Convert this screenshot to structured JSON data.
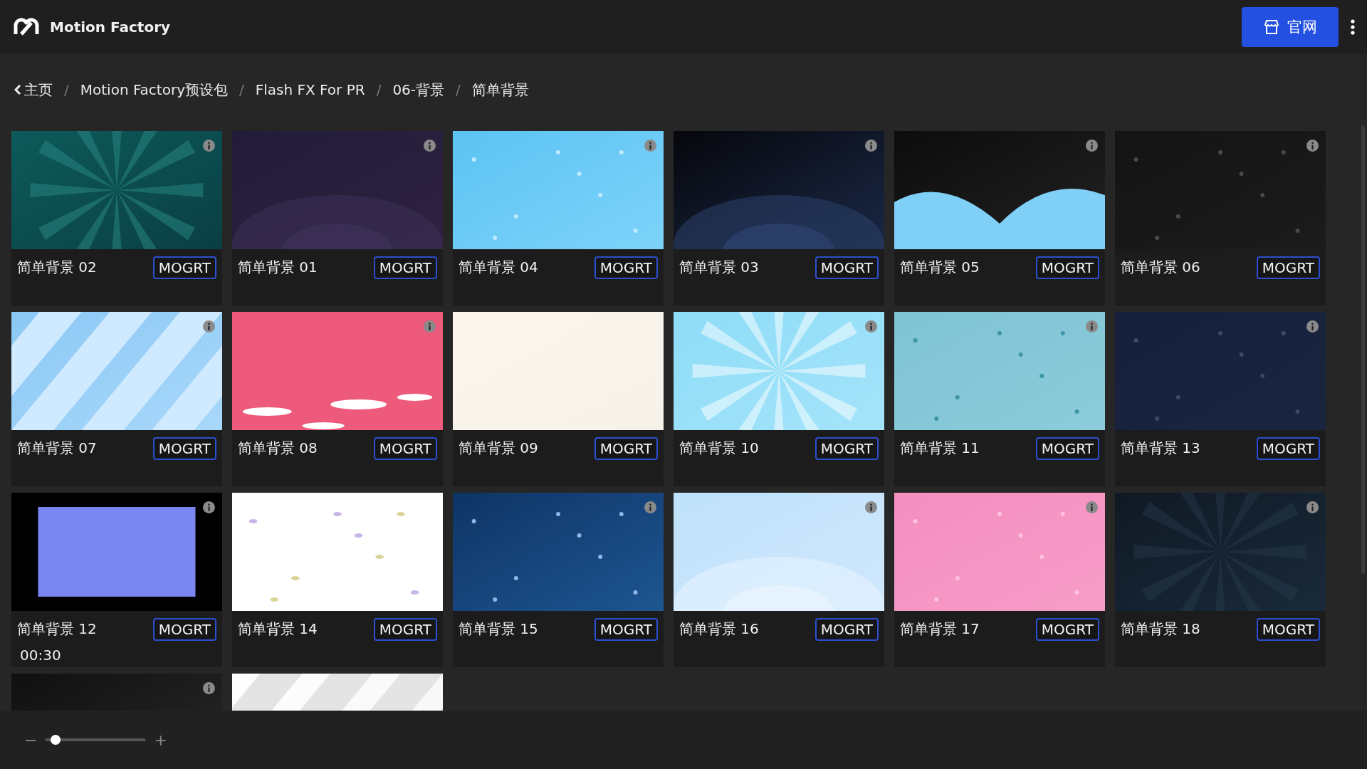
{
  "header": {
    "app_name": "Motion Factory",
    "website_button": "官网"
  },
  "breadcrumb": [
    {
      "label": "主页",
      "back": true
    },
    {
      "label": "Motion Factory预设包",
      "back": false
    },
    {
      "label": "Flash FX For PR",
      "back": false
    },
    {
      "label": "06-背景",
      "back": false
    },
    {
      "label": "简单背景",
      "back": false
    }
  ],
  "breadcrumb_separator": "/",
  "cards": [
    {
      "title": "简单背景 02",
      "button": "MOGRT",
      "info_icon": true
    },
    {
      "title": "简单背景 01",
      "button": "MOGRT",
      "info_icon": true
    },
    {
      "title": "简单背景 04",
      "button": "MOGRT",
      "info_icon": true
    },
    {
      "title": "简单背景 03",
      "button": "MOGRT",
      "info_icon": true
    },
    {
      "title": "简单背景 05",
      "button": "MOGRT",
      "info_icon": true
    },
    {
      "title": "简单背景 06",
      "button": "MOGRT",
      "info_icon": true
    },
    {
      "title": "简单背景 07",
      "button": "MOGRT",
      "info_icon": true
    },
    {
      "title": "简单背景 08",
      "button": "MOGRT",
      "info_icon": true
    },
    {
      "title": "简单背景 09",
      "button": "MOGRT",
      "info_icon": false
    },
    {
      "title": "简单背景 10",
      "button": "MOGRT",
      "info_icon": true
    },
    {
      "title": "简单背景 11",
      "button": "MOGRT",
      "info_icon": true
    },
    {
      "title": "简单背景 13",
      "button": "MOGRT",
      "info_icon": true
    },
    {
      "title": "简单背景 12",
      "button": "MOGRT",
      "info_icon": true,
      "duration": "00:30"
    },
    {
      "title": "简单背景 14",
      "button": "MOGRT",
      "info_icon": false
    },
    {
      "title": "简单背景 15",
      "button": "MOGRT",
      "info_icon": true
    },
    {
      "title": "简单背景 16",
      "button": "MOGRT",
      "info_icon": true
    },
    {
      "title": "简单背景 17",
      "button": "MOGRT",
      "info_icon": true
    },
    {
      "title": "简单背景 18",
      "button": "MOGRT",
      "info_icon": true
    }
  ],
  "partial_cards": [
    {
      "info_icon": true
    },
    {
      "info_icon": false
    }
  ],
  "zoom_slider": {
    "minus": "−",
    "plus": "+",
    "level": 0.05
  }
}
